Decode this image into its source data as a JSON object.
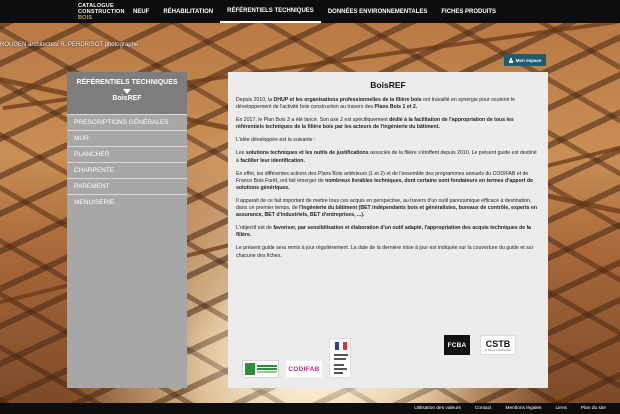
{
  "header": {
    "logo_lines": [
      "CATALOGUE",
      "CONSTRUCTION",
      "BOIS"
    ],
    "nav": [
      "NEUF",
      "RÉHABILITATION",
      "RÉFÉRENTIELS TECHNIQUES",
      "DONNÉES ENVIRONNEMENTALES",
      "FICHES PRODUITS"
    ],
    "active_nav": "RÉFÉRENTIELS TECHNIQUES"
  },
  "photo_credit": "ROUGEN architectes/ R. PERDRISOT photographe",
  "mon_espace_label": "Mon espace",
  "sidebar": {
    "heading": "RÉFÉRENTIELS TECHNIQUES",
    "subheading": "BoisREF",
    "items": [
      "PRESCRIPTIONS GÉNÉRALES",
      "MUR",
      "PLANCHER",
      "CHARPENTE",
      "PAREMENT",
      "MENUISERIE"
    ]
  },
  "content": {
    "title": "BoisREF",
    "p1": [
      "Depuis 2010, la ",
      "DHUP et les organisations professionnelles de la filière bois",
      " ont travaillé en synergie pour soutenir le développement de l'activité bois construction au travers des ",
      "Plans Bois 1 et 2."
    ],
    "p2": [
      "En 2017, le Plan Bois 3 a été lancé. Son axe 2 est spécifiquement ",
      "dédié à la facilitation de l'appropriation de tous les référentiels techniques de la filière bois par les acteurs de l'ingénierie du bâtiment."
    ],
    "p3": "L'idée développée est la suivante :",
    "p4": [
      "Les ",
      "solutions techniques et les outils de justifications",
      " associés de la filière s'étoffent depuis 2010. Le présent guide est destiné à ",
      "faciliter leur identification."
    ],
    "p5": [
      "En effet, les différentes actions des Plans Bois antérieurs (1 et 2) et de l'ensemble des programmes annuels du CODIFAB et de France Bois Forêt, ont fait émerger de ",
      "nombreux livrables techniques, dont certains sont fondateurs en termes d'apport de solutions génériques."
    ],
    "p6": [
      "Il apparait de ce fait important de mettre tous ces acquis en perspective, au travers d'un outil panoramique efficace à destination, dans un premier temps, de ",
      "l'ingénierie du bâtiment (BET indépendants bois et généralistes, bureaux de contrôle, experts en assurance, BET d'industriels, BET d'entreprises, ...)."
    ],
    "p7": [
      "L'objectif est de ",
      "favoriser, par sensibilisation et élaboration d'un outil adapté, l'appropriation des acquis techniques de la filière."
    ],
    "p8": "Le présent guide sera remis à jour régulièrement. La date de la dernière mise à jour est indiquée sur la couverture du guide et sur chacune des fiches."
  },
  "logos": {
    "codifab": "CODIFAB",
    "fcba": "FCBA",
    "cstb": "CSTB",
    "cstb_sub": "le futur en construction"
  },
  "footer": [
    "Utilisation des valeurs",
    "Contact",
    "Mentions légales",
    "Liens",
    "Plan du site"
  ]
}
